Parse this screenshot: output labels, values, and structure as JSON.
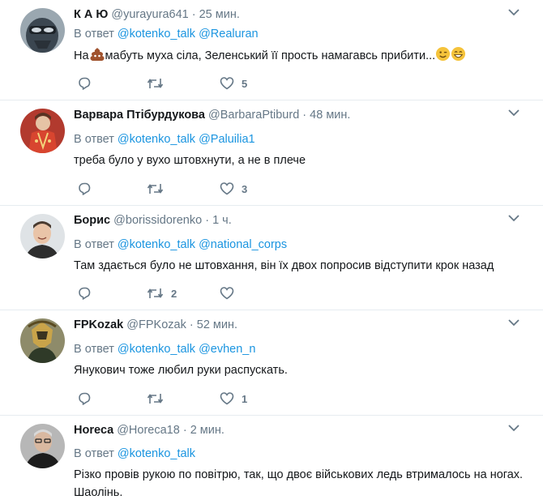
{
  "reply_prefix": "В ответ",
  "tweets": [
    {
      "name": "К А Ю",
      "handle": "@yurayura641",
      "separator": "·",
      "time": "25 мин.",
      "mentions": [
        "@kotenko_talk",
        "@Realuran"
      ],
      "text_before": "На",
      "text_after": "мабуть муха сіла, Зеленський її прость намагавсь прибити...",
      "emojis": [
        "poop-emoji",
        "wink-emoji",
        "grin-emoji"
      ],
      "reply_count": "",
      "retweet_count": "",
      "like_count": "5",
      "avatar_color": "#4a5a66"
    },
    {
      "name": "Варвара Птібурдукова",
      "handle": "@BarbaraPtiburd",
      "separator": "·",
      "time": "48 мин.",
      "mentions": [
        "@kotenko_talk",
        "@Paluilia1"
      ],
      "text": "треба було у вухо штовхнути, а не в плече",
      "reply_count": "",
      "retweet_count": "",
      "like_count": "3",
      "avatar_color": "#c0392b"
    },
    {
      "name": "Борис",
      "handle": "@borissidorenko",
      "separator": "·",
      "time": "1 ч.",
      "mentions": [
        "@kotenko_talk",
        "@national_corps"
      ],
      "text": "Там здається було не штовхання, він їх двох попросив відступити крок назад",
      "reply_count": "",
      "retweet_count": "2",
      "like_count": "",
      "avatar_color": "#e8d2c0"
    },
    {
      "name": "FPKozak",
      "handle": "@FPKozak",
      "separator": "·",
      "time": "52 мин.",
      "mentions": [
        "@kotenko_talk",
        "@evhen_n"
      ],
      "text": "Янукович тоже любил руки распускать.",
      "reply_count": "",
      "retweet_count": "",
      "like_count": "1",
      "avatar_color": "#6b6a3e"
    },
    {
      "name": "Horeca",
      "handle": "@Horeca18",
      "separator": "·",
      "time": "2 мин.",
      "mentions": [
        "@kotenko_talk"
      ],
      "text": "Різко провів рукою по повітрю, так, що двоє військових ледь втрималось на ногах. Шаолінь.",
      "reply_count": "",
      "retweet_count": "",
      "like_count": "",
      "avatar_color": "#5a5a5a"
    }
  ],
  "colors": {
    "link": "#1b95e0",
    "muted": "#657786",
    "text": "#14171a",
    "divider": "#e6ecf0"
  }
}
